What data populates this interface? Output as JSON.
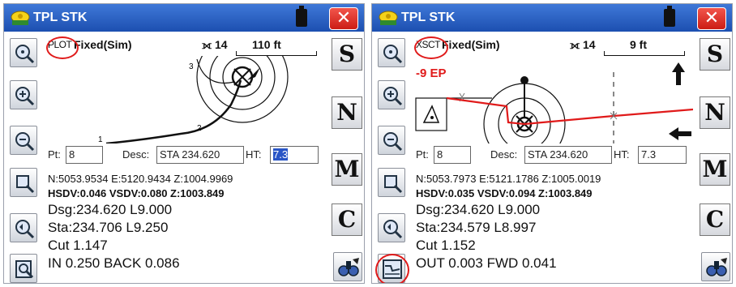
{
  "left": {
    "title": "TPL STK",
    "close": "✕",
    "mode": "PLOT",
    "fix": "Fixed(Sim)",
    "sat_icon": "⟗",
    "sats": "14",
    "distance": "110 ft",
    "map_labels": [
      "3",
      "2",
      "1"
    ],
    "pt_label": "Pt:",
    "pt_value": "8",
    "desc_label": "Desc:",
    "desc_value": "STA 234.620",
    "ht_label": "HT:",
    "ht_value": "7.3",
    "coords": "N:5053.9534    E:5120.9434    Z:1004.9969",
    "sdv": "HSDV:0.046 VSDV:0.080 Z:1003.849",
    "dsg": "Dsg:234.620 L9.000",
    "sta": "Sta:234.706 L9.250",
    "cut": "Cut 1.147",
    "dir": "IN 0.250 BACK 0.086",
    "right_buttons": [
      "S",
      "N",
      "M",
      "C"
    ]
  },
  "right": {
    "title": "TPL STK",
    "close": "✕",
    "mode": "XSCT",
    "fix": "Fixed(Sim)",
    "sat_icon": "⟗",
    "sats": "14",
    "distance": "9 ft",
    "ep": "-9 EP",
    "pt_label": "Pt:",
    "pt_value": "8",
    "desc_label": "Desc:",
    "desc_value": "STA 234.620",
    "ht_label": "HT:",
    "ht_value": "7.3",
    "coords": "N:5053.7973    E:5121.1786    Z:1005.0019",
    "sdv": "HSDV:0.035 VSDV:0.094 Z:1003.849",
    "dsg": "Dsg:234.620 L9.000",
    "sta": "Sta:234.579 L8.997",
    "cut": "Cut 1.152",
    "dir": "OUT 0.003 FWD 0.041",
    "right_buttons": [
      "S",
      "N",
      "M",
      "C"
    ]
  },
  "icons": {
    "left_sidebar": [
      "zoom-extents-icon",
      "zoom-in-icon",
      "zoom-out-icon",
      "zoom-window-icon",
      "zoom-previous-icon",
      "layers-icon"
    ],
    "right_sidebar_left": [
      "zoom-extents-icon",
      "zoom-in-icon",
      "zoom-out-icon",
      "zoom-window-icon",
      "zoom-previous-icon",
      "cross-section-icon"
    ],
    "bottom_right": "binoculars-icon"
  },
  "colors": {
    "titlebar": "#1c4fb0",
    "close": "#cc1d14",
    "highlight_circle": "#e01a1a",
    "selection": "#2a56c6",
    "design_line": "#e01a1a"
  }
}
